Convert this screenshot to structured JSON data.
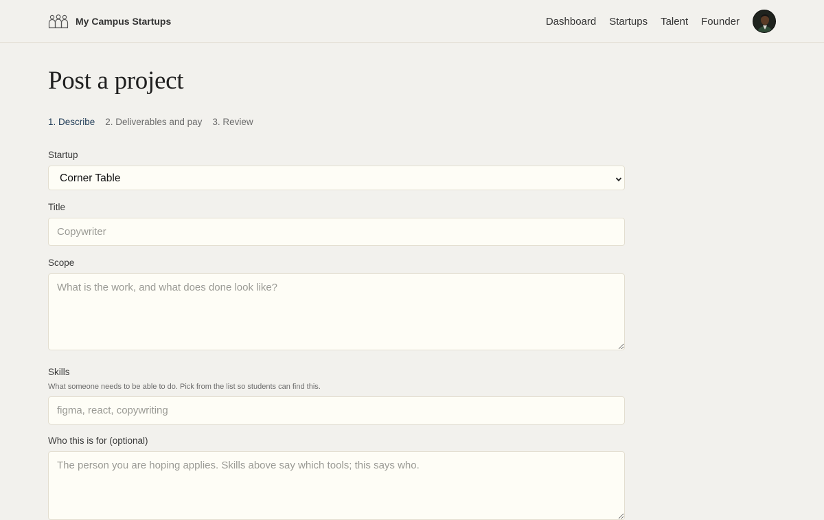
{
  "brand": {
    "name": "My Campus Startups",
    "logo_icon": "people-group-icon"
  },
  "nav": {
    "items": [
      {
        "label": "Dashboard"
      },
      {
        "label": "Startups"
      },
      {
        "label": "Talent"
      },
      {
        "label": "Founder"
      }
    ],
    "avatar_icon": "user-avatar"
  },
  "page": {
    "title": "Post a project"
  },
  "steps": [
    {
      "label": "1. Describe",
      "active": true
    },
    {
      "label": "2. Deliverables and pay",
      "active": false
    },
    {
      "label": "3. Review",
      "active": false
    }
  ],
  "form": {
    "startup": {
      "label": "Startup",
      "value": "Corner Table"
    },
    "title": {
      "label": "Title",
      "placeholder": "Copywriter",
      "value": ""
    },
    "scope": {
      "label": "Scope",
      "placeholder": "What is the work, and what does done look like?",
      "value": ""
    },
    "skills": {
      "label": "Skills",
      "help": "What someone needs to be able to do. Pick from the list so students can find this.",
      "placeholder": "figma, react, copywriting",
      "value": ""
    },
    "audience": {
      "label": "Who this is for (optional)",
      "placeholder": "The person you are hoping applies. Skills above say which tools; this says who.",
      "value": ""
    }
  },
  "colors": {
    "background": "#f2f1ed",
    "input_bg": "#fefdf6",
    "active_step": "#1e3a56",
    "border": "#e3ded0"
  }
}
